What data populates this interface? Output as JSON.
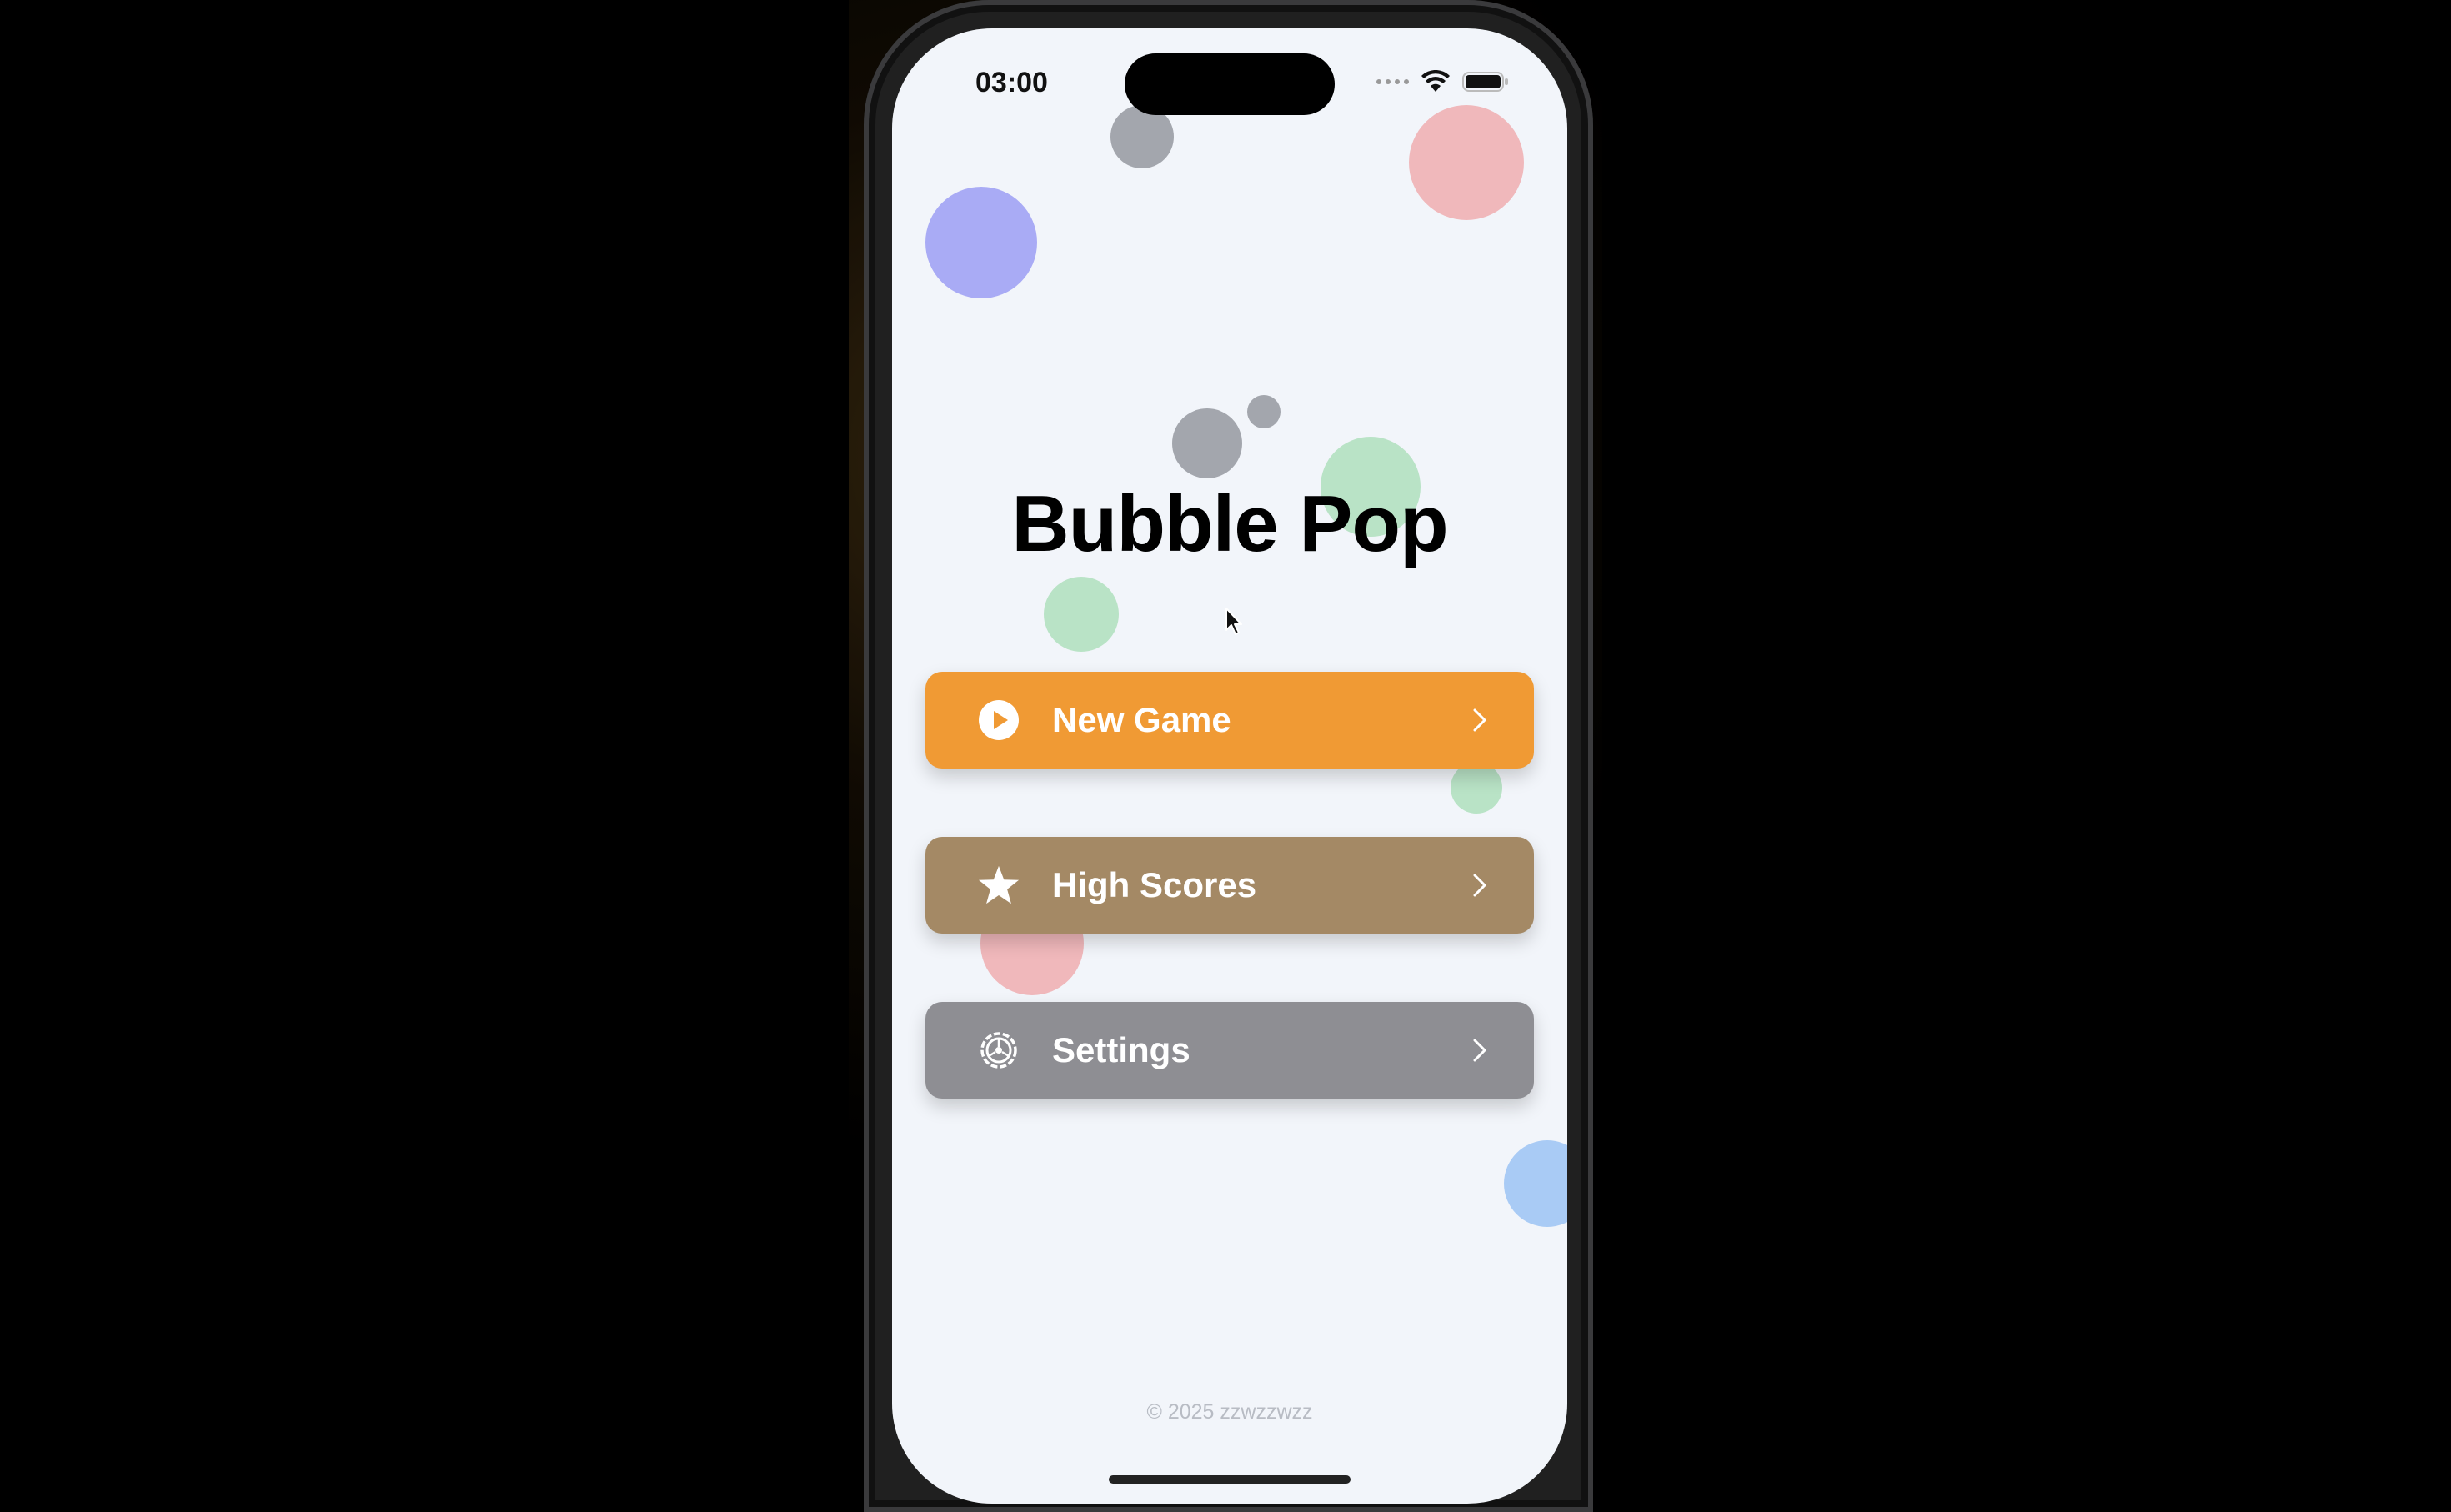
{
  "status_bar": {
    "time": "03:00"
  },
  "app": {
    "title": "Bubble Pop"
  },
  "menu": [
    {
      "label": "New Game",
      "icon": "play-circle-icon",
      "color": "#f09a34"
    },
    {
      "label": "High Scores",
      "icon": "star-icon",
      "color": "#a48965"
    },
    {
      "label": "Settings",
      "icon": "gear-icon",
      "color": "#8e8e93"
    }
  ],
  "footer": {
    "text": "© 2025 zzwzzwzz"
  },
  "colors": {
    "background": "#f2f5fa",
    "bubble_purple": "#a9abf5",
    "bubble_red": "#f0b8bb",
    "bubble_gray": "#a3a6ad",
    "bubble_green": "#b9e3c6",
    "bubble_blue": "#a9cbf5"
  }
}
